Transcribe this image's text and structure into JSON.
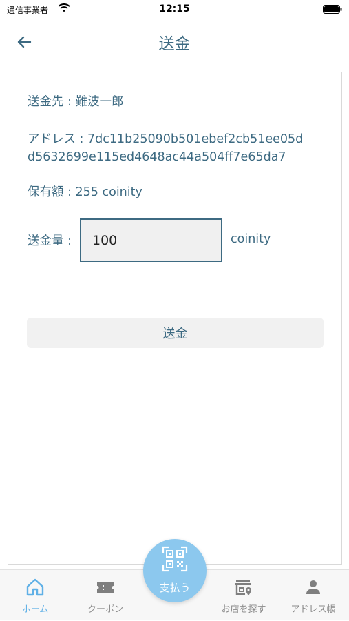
{
  "status_bar": {
    "carrier": "通信事業者",
    "time": "12:15"
  },
  "nav": {
    "title": "送金",
    "back_icon": "arrow-left-icon"
  },
  "transfer": {
    "recipient": "送金先 : 難波一郎",
    "address_line1": "アドレス : 7dc11b25090b501ebef2cb51ee05d",
    "address_line2": "d5632699e115ed4648ac44a504ff7e65da7",
    "balance": "保有額 : 255 coinity",
    "amount_label": "送金量 :",
    "amount_value": "100",
    "unit": "coinity",
    "send_button": "送金"
  },
  "tab_bar": {
    "items": [
      {
        "label": "ホーム",
        "icon": "home-icon",
        "active": true
      },
      {
        "label": "クーポン",
        "icon": "coupon-icon",
        "active": false
      },
      {
        "label": "お店を探す",
        "icon": "store-search-icon",
        "active": false
      },
      {
        "label": "アドレス帳",
        "icon": "person-icon",
        "active": false
      }
    ],
    "pay_button": {
      "label": "支払う",
      "icon": "qr-code-icon"
    }
  },
  "colors": {
    "primary": "#3d6a82",
    "accent": "#5fb0e6",
    "pay_button_bg": "#8cc8ee"
  }
}
